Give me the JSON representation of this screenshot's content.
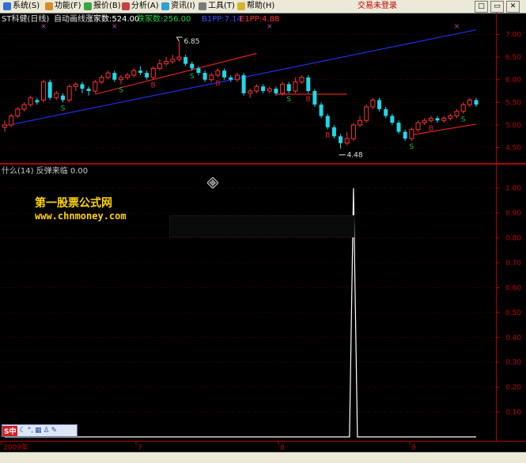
{
  "menu": {
    "items": [
      {
        "label": "系统(S)",
        "icon_color": "#2f6fd6"
      },
      {
        "label": "功能(F)",
        "icon_color": "#d68b2f"
      },
      {
        "label": "报价(B)",
        "icon_color": "#3aa544"
      },
      {
        "label": "分析(A)",
        "icon_color": "#c84040"
      },
      {
        "label": "资讯(I)",
        "icon_color": "#2f9fd6"
      },
      {
        "label": "工具(T)",
        "icon_color": "#7a7a7a"
      },
      {
        "label": "帮助(H)",
        "icon_color": "#d6b42f"
      }
    ],
    "login_status": "交易未登录",
    "window_buttons": [
      "□",
      "▭",
      "✕"
    ]
  },
  "chart_header": {
    "stock": "ST科健(日线)",
    "mode": "自动画线",
    "rise_label": "涨家数:524.00",
    "fall_label": "跌家数:256.00",
    "b1pp": "B1PP:7.14",
    "e1pp": "E1PP:4.88"
  },
  "indicator_header": "什么(14) 反弹来临 0.00",
  "watermark": {
    "name": "第一股票公式网",
    "url": "www.chnmoney.com"
  },
  "annotations": {
    "high_label": "6.85",
    "low_label": "4.48"
  },
  "axis": {
    "price_ticks": [
      "7.00",
      "6.50",
      "6.00",
      "5.50",
      "5.00",
      "4.50"
    ],
    "indicator_ticks": [
      "1.00",
      "0.90",
      "0.80",
      "0.70",
      "0.60",
      "0.50",
      "0.40",
      "0.30",
      "0.20",
      "0.10"
    ],
    "time_labels": [
      "2009年",
      "7",
      "8",
      "9"
    ]
  },
  "colors": {
    "up": "#ff3030",
    "down": "#20d8e8",
    "grid": "#7a0000",
    "axis_text": "#c00000",
    "trend_blue": "#2030e0",
    "trend_red": "#e02020",
    "rise_text": "#ffffff",
    "fall_text": "#20d040",
    "b1pp_text": "#3050ff",
    "e1pp_text": "#ff3030",
    "signal_s": "#20c040",
    "signal_b": "#e02020",
    "marker_x": "#c040c0"
  },
  "ime_bar": {
    "label": "S中"
  },
  "chart_data": [
    {
      "type": "candlestick",
      "ylim": [
        4.3,
        7.2
      ],
      "candles": [
        [
          4.95,
          5.0,
          4.85,
          5.1
        ],
        [
          5.0,
          5.2,
          4.95,
          5.25
        ],
        [
          5.2,
          5.35,
          5.15,
          5.4
        ],
        [
          5.35,
          5.45,
          5.3,
          5.5
        ],
        [
          5.45,
          5.6,
          5.4,
          5.65
        ],
        [
          5.55,
          5.5,
          5.45,
          5.6
        ],
        [
          5.55,
          5.95,
          5.5,
          6.0
        ],
        [
          5.95,
          5.6,
          5.55,
          6.0
        ],
        [
          5.6,
          5.7,
          5.55,
          5.75
        ],
        [
          5.65,
          5.55,
          5.5,
          5.7
        ],
        [
          5.55,
          5.85,
          5.5,
          5.9
        ],
        [
          5.85,
          5.9,
          5.75,
          5.95
        ],
        [
          5.9,
          5.8,
          5.7,
          5.95
        ],
        [
          5.8,
          5.75,
          5.65,
          5.85
        ],
        [
          5.75,
          5.95,
          5.7,
          6.0
        ],
        [
          5.95,
          6.05,
          5.9,
          6.1
        ],
        [
          6.05,
          6.15,
          6.0,
          6.2
        ],
        [
          6.15,
          6.0,
          5.95,
          6.2
        ],
        [
          6.0,
          6.05,
          5.9,
          6.1
        ],
        [
          6.05,
          6.1,
          6.0,
          6.15
        ],
        [
          6.1,
          6.2,
          6.05,
          6.25
        ],
        [
          6.2,
          6.15,
          6.1,
          6.3
        ],
        [
          6.15,
          6.05,
          6.0,
          6.2
        ],
        [
          6.05,
          6.25,
          6.0,
          6.3
        ],
        [
          6.25,
          6.35,
          6.2,
          6.45
        ],
        [
          6.35,
          6.4,
          6.3,
          6.5
        ],
        [
          6.4,
          6.45,
          6.35,
          6.55
        ],
        [
          6.45,
          6.5,
          6.4,
          6.85
        ],
        [
          6.5,
          6.35,
          6.3,
          6.55
        ],
        [
          6.35,
          6.25,
          6.2,
          6.4
        ],
        [
          6.25,
          6.15,
          6.1,
          6.3
        ],
        [
          6.15,
          6.0,
          5.95,
          6.2
        ],
        [
          6.0,
          6.1,
          5.95,
          6.15
        ],
        [
          6.1,
          6.2,
          6.05,
          6.25
        ],
        [
          6.2,
          6.05,
          6.0,
          6.25
        ],
        [
          6.05,
          6.0,
          5.95,
          6.1
        ],
        [
          6.0,
          6.1,
          5.95,
          6.15
        ],
        [
          6.1,
          5.7,
          5.65,
          6.15
        ],
        [
          5.7,
          5.75,
          5.6,
          5.8
        ],
        [
          5.75,
          5.85,
          5.7,
          5.9
        ],
        [
          5.85,
          5.75,
          5.7,
          5.9
        ],
        [
          5.75,
          5.8,
          5.7,
          5.85
        ],
        [
          5.8,
          5.7,
          5.65,
          5.85
        ],
        [
          5.7,
          5.9,
          5.65,
          5.95
        ],
        [
          5.9,
          5.75,
          5.7,
          5.95
        ],
        [
          5.75,
          5.95,
          5.7,
          6.05
        ],
        [
          5.95,
          6.05,
          5.9,
          6.1
        ],
        [
          6.05,
          5.75,
          5.7,
          6.1
        ],
        [
          5.75,
          5.45,
          5.4,
          5.8
        ],
        [
          5.45,
          5.2,
          5.15,
          5.5
        ],
        [
          5.2,
          4.95,
          4.9,
          5.25
        ],
        [
          4.95,
          4.75,
          4.7,
          5.0
        ],
        [
          4.75,
          4.6,
          4.48,
          4.8
        ],
        [
          4.6,
          4.7,
          4.55,
          4.85
        ],
        [
          4.7,
          5.0,
          4.65,
          5.05
        ],
        [
          5.0,
          5.1,
          4.95,
          5.2
        ],
        [
          5.1,
          5.4,
          5.05,
          5.45
        ],
        [
          5.4,
          5.55,
          5.35,
          5.6
        ],
        [
          5.55,
          5.35,
          5.3,
          5.6
        ],
        [
          5.35,
          5.2,
          5.15,
          5.4
        ],
        [
          5.2,
          5.05,
          5.0,
          5.25
        ],
        [
          5.05,
          4.85,
          4.8,
          5.1
        ],
        [
          4.85,
          4.7,
          4.65,
          4.9
        ],
        [
          4.7,
          4.9,
          4.65,
          4.95
        ],
        [
          4.9,
          5.05,
          4.85,
          5.1
        ],
        [
          5.05,
          5.1,
          5.0,
          5.15
        ],
        [
          5.1,
          5.15,
          5.05,
          5.2
        ],
        [
          5.15,
          5.1,
          5.05,
          5.2
        ],
        [
          5.1,
          5.15,
          5.05,
          5.2
        ],
        [
          5.15,
          5.2,
          5.1,
          5.25
        ],
        [
          5.2,
          5.3,
          5.15,
          5.35
        ],
        [
          5.3,
          5.45,
          5.25,
          5.5
        ],
        [
          5.45,
          5.55,
          5.4,
          5.6
        ],
        [
          5.55,
          5.45,
          5.4,
          5.6
        ]
      ],
      "signals": [
        {
          "i": 9,
          "kind": "S"
        },
        {
          "i": 18,
          "kind": "S"
        },
        {
          "i": 23,
          "kind": "B"
        },
        {
          "i": 29,
          "kind": "S"
        },
        {
          "i": 33,
          "kind": "B"
        },
        {
          "i": 44,
          "kind": "S"
        },
        {
          "i": 47,
          "kind": "B"
        },
        {
          "i": 50,
          "kind": "B"
        },
        {
          "i": 63,
          "kind": "S"
        },
        {
          "i": 66,
          "kind": "B"
        },
        {
          "i": 71,
          "kind": "S"
        }
      ]
    },
    {
      "type": "line",
      "ylim": [
        0,
        1.05
      ],
      "series": [
        {
          "values": [
            0,
            0,
            0,
            0,
            0,
            0,
            0,
            0,
            0,
            0,
            0,
            0,
            0,
            0,
            0,
            0,
            0,
            0,
            0,
            0,
            0,
            0,
            0,
            0,
            0,
            0,
            0,
            0,
            0,
            0,
            0,
            0,
            0,
            0,
            0,
            0,
            0,
            0,
            0,
            0,
            0,
            0,
            0,
            0,
            0,
            0,
            0,
            0,
            0,
            0,
            0,
            0,
            0,
            0,
            1,
            0,
            0,
            0,
            0,
            0,
            0,
            0,
            0,
            0,
            0,
            0,
            0,
            0,
            0,
            0,
            0,
            0,
            0,
            0
          ]
        }
      ]
    }
  ]
}
